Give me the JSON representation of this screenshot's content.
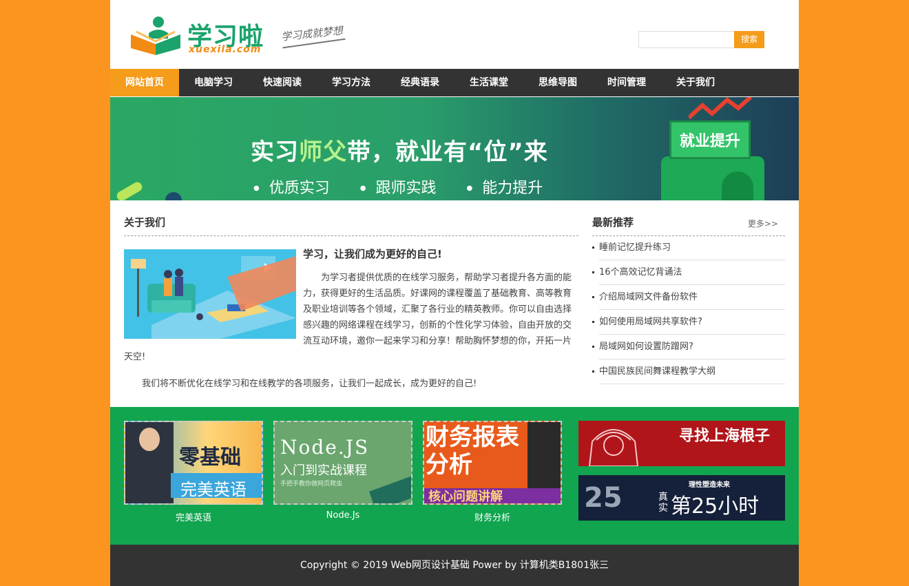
{
  "header": {
    "logo_text": "学习啦",
    "logo_sub": "xuexila.com",
    "slogan": "学习成就梦想",
    "search_placeholder": "",
    "search_button": "搜索"
  },
  "nav": {
    "items": [
      {
        "label": "网站首页"
      },
      {
        "label": "电脑学习"
      },
      {
        "label": "快速阅读"
      },
      {
        "label": "学习方法"
      },
      {
        "label": "经典语录"
      },
      {
        "label": "生活课堂"
      },
      {
        "label": "思维导图"
      },
      {
        "label": "时间管理"
      },
      {
        "label": "关于我们"
      }
    ]
  },
  "banner": {
    "title_part1": "实习",
    "title_highlight": "师父",
    "title_part2": "带，就业有“位”来",
    "points": [
      "优质实习",
      "跟师实践",
      "能力提升"
    ],
    "badge": "就业提升"
  },
  "about": {
    "heading": "关于我们",
    "title": "学习，让我们成为更好的自己!",
    "paragraph1": "为学习者提供优质的在线学习服务，帮助学习者提升各方面的能力，获得更好的生活品质。好课网的课程覆盖了基础教育、高等教育及职业培训等各个领域，汇聚了各行业的精英教师。你可以自由选择感兴趣的网络课程在线学习，创新的个性化学习体验，自由开放的交流互动环境，邀你一起来学习和分享！帮助胸怀梦想的你，开拓一片天空!",
    "paragraph2": "我们将不断优化在线学习和在线教学的各项服务，让我们一起成长，成为更好的自己!"
  },
  "recommend": {
    "heading": "最新推荐",
    "more": "更多>>",
    "items": [
      "睡前记忆提升练习",
      "16个高效记忆背诵法",
      "介绍局域网文件备份软件",
      "如何使用局域网共享软件?",
      "局域网如何设置防蹭网?",
      "中国民族民间舞课程教学大纲"
    ]
  },
  "courses": [
    {
      "label": "完美英语",
      "big": "零基础",
      "sub": "完美英语"
    },
    {
      "label": "Node.Js",
      "big": "Node.JS",
      "sub": "入门到实战课程",
      "tiny": "手把手教你做网页爬虫"
    },
    {
      "label": "财务分析",
      "big": "财务报表分析",
      "sub": "核心问题讲解"
    }
  ],
  "ads": [
    {
      "text": "寻找上海根子"
    },
    {
      "small": "理性塑造未来",
      "prefix": "真实",
      "text": "第25小时"
    }
  ],
  "footer": {
    "copyright": "Copyright © 2019 Web网页设计基础 Power by 计算机类B1801张三"
  },
  "colors": {
    "page_bg": "#fb9520",
    "accent": "#f59c1a",
    "nav_bg": "#333333",
    "band_green": "#11a54f",
    "logo_green": "#1aa36b"
  }
}
